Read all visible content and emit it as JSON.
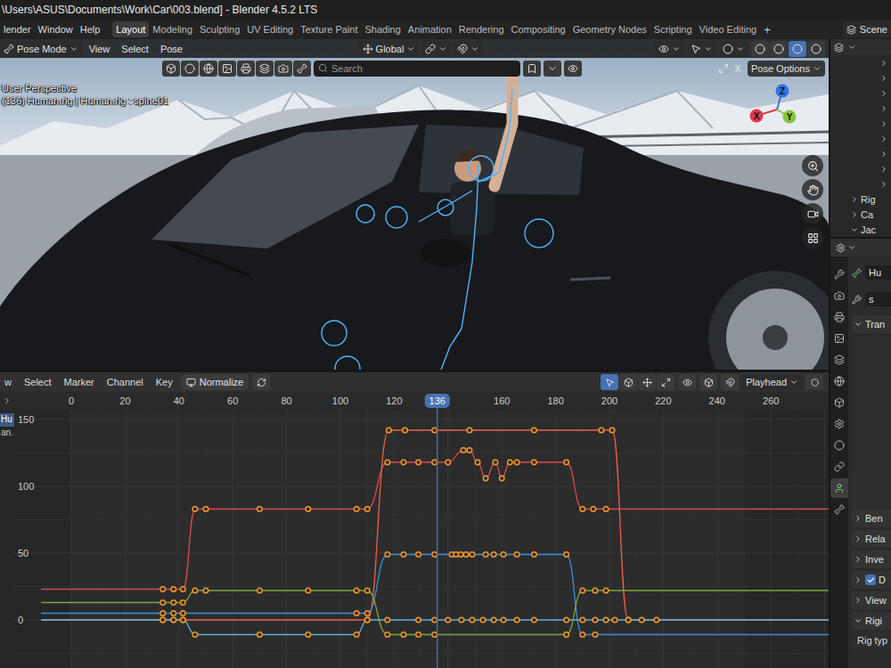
{
  "window": {
    "title": "\\Users\\ASUS\\Documents\\Work\\Car\\003.blend] - Blender 4.5.2 LTS"
  },
  "menus": [
    "lender",
    "Window",
    "Help"
  ],
  "workspaces": [
    {
      "label": "Layout",
      "selected": true
    },
    {
      "label": "Modeling",
      "selected": false
    },
    {
      "label": "Sculpting",
      "selected": false
    },
    {
      "label": "UV Editing",
      "selected": false
    },
    {
      "label": "Texture Paint",
      "selected": false
    },
    {
      "label": "Shading",
      "selected": false
    },
    {
      "label": "Animation",
      "selected": false
    },
    {
      "label": "Rendering",
      "selected": false
    },
    {
      "label": "Compositing",
      "selected": false
    },
    {
      "label": "Geometry Nodes",
      "selected": false
    },
    {
      "label": "Scripting",
      "selected": false
    },
    {
      "label": "Video Editing",
      "selected": false
    }
  ],
  "add_workspace": "+",
  "scene": "Scene",
  "viewport": {
    "mode": "Pose Mode",
    "menus": [
      "View",
      "Select",
      "Pose"
    ],
    "orientation": "Global",
    "search": {
      "placeholder": "Search"
    },
    "close": "X",
    "pose_options": "Pose Options",
    "info": [
      "User Perspective",
      "(136) Human.rig | Human.rig : spine01"
    ],
    "gizmo": [
      {
        "label": "Z",
        "color": "#2f74e6"
      },
      {
        "label": "X",
        "color": "#e0384c"
      },
      {
        "label": "Y",
        "color": "#86c43a"
      }
    ],
    "shading_modes": [
      {
        "selected": false
      },
      {
        "selected": false
      },
      {
        "selected": true
      },
      {
        "selected": false
      }
    ]
  },
  "graph_editor": {
    "menus": [
      "w",
      "Select",
      "Marker",
      "Channel",
      "Key"
    ],
    "normalize": {
      "label": "Normalize",
      "on": false
    },
    "tools": [
      {
        "selected": true
      },
      {
        "selected": false
      },
      {
        "selected": false
      },
      {
        "selected": false
      }
    ],
    "pivot": "Playhead",
    "channels": [
      {
        "label": "Hu",
        "selected": true
      },
      {
        "label": "an.",
        "selected": false
      }
    ],
    "playhead": "136",
    "x_ticks": [
      "0",
      "20",
      "40",
      "60",
      "80",
      "100",
      "120",
      "160",
      "180",
      "200",
      "220",
      "240",
      "260"
    ],
    "y_ticks": [
      "150",
      "100",
      "50",
      "0"
    ],
    "series": [
      {
        "color": "#d94a4a",
        "frames": [
          34,
          38,
          41.5,
          46,
          50,
          70,
          88,
          106,
          110,
          117.5,
          123.5,
          129,
          135,
          140,
          145.7,
          148,
          151,
          154,
          157.6,
          160,
          163,
          165.6,
          172,
          184,
          190,
          194,
          198.7
        ],
        "values": [
          23,
          23,
          23,
          83,
          83,
          83,
          83,
          83,
          83,
          118,
          118,
          118,
          118,
          118,
          127,
          127,
          118,
          106,
          118,
          106,
          118,
          118,
          118,
          118,
          83,
          83,
          83
        ]
      },
      {
        "color": "#e8604c",
        "frames": [
          34,
          38,
          41.5,
          110,
          118,
          124,
          135,
          148,
          172,
          197,
          201,
          207,
          212,
          217.5
        ],
        "values": [
          0,
          0,
          0,
          0,
          142,
          142,
          142,
          142,
          142,
          142,
          142,
          0,
          0,
          0
        ]
      },
      {
        "color": "#3b8fd9",
        "frames": [
          34,
          38,
          41.5,
          106,
          110,
          117.5,
          123.5,
          129,
          135,
          141.4,
          143,
          144.7,
          146.7,
          149,
          154,
          157,
          160.6,
          165.6,
          172,
          184,
          190,
          194.7
        ],
        "values": [
          5,
          5,
          5,
          5,
          5,
          49,
          49,
          49,
          49,
          49,
          49,
          49,
          49,
          49,
          49,
          49,
          49,
          49,
          49,
          49,
          -11,
          -11
        ]
      },
      {
        "color": "#78a83a",
        "frames": [
          34,
          38,
          41.5,
          46,
          50,
          70,
          88,
          106,
          110,
          117.5,
          123.5,
          129,
          135,
          184,
          190,
          194.7,
          198.7
        ],
        "values": [
          13,
          13,
          13,
          22,
          22,
          22,
          22,
          22,
          22,
          -11,
          -11,
          -11,
          -11,
          -11,
          22,
          22,
          22
        ]
      },
      {
        "color": "#5ab4de",
        "frames": [
          34,
          38,
          41.5,
          46,
          70,
          88,
          106,
          110,
          117.5,
          129,
          135,
          140,
          145,
          149,
          153,
          157,
          160.6,
          165.6,
          172,
          184,
          190,
          194.7,
          198.7,
          202,
          207
        ],
        "values": [
          0,
          0,
          0,
          -11,
          -11,
          -11,
          -11,
          0,
          0,
          0,
          0,
          0,
          0,
          0,
          0,
          0,
          0,
          0,
          0,
          0,
          0,
          0,
          0,
          0,
          0
        ]
      }
    ]
  },
  "outliner": {
    "rows": [
      {
        "label": "",
        "expanded": false
      },
      {
        "label": "",
        "expanded": false
      },
      {
        "label": "",
        "expanded": false
      },
      {
        "label": "",
        "expanded": false
      },
      {
        "label": "",
        "expanded": false
      },
      {
        "label": "",
        "expanded": false
      },
      {
        "label": "",
        "expanded": false
      },
      {
        "label": "",
        "expanded": false
      },
      {
        "label": "",
        "expanded": false
      },
      {
        "label": "Rig",
        "expanded": false
      },
      {
        "label": "Ca",
        "expanded": false
      },
      {
        "label": "Jac",
        "expanded": true
      }
    ]
  },
  "properties": {
    "tabs": [
      {
        "selected": false
      },
      {
        "selected": false
      },
      {
        "selected": false
      },
      {
        "selected": false
      },
      {
        "selected": false
      },
      {
        "selected": false
      },
      {
        "selected": false
      },
      {
        "selected": false
      },
      {
        "selected": false
      },
      {
        "selected": false
      },
      {
        "selected": true
      },
      {
        "selected": false
      }
    ],
    "object": "Hu",
    "context": "s",
    "panels": [
      {
        "label": "Tran",
        "expanded": true,
        "kind": "panel",
        "fields": []
      },
      {
        "label": "Ben",
        "expanded": false,
        "kind": "panel",
        "fields": []
      },
      {
        "label": "Rela",
        "expanded": false,
        "kind": "panel",
        "fields": []
      },
      {
        "label": "Inve",
        "expanded": false,
        "kind": "panel",
        "fields": []
      },
      {
        "label": "D",
        "expanded": false,
        "kind": "checkbox",
        "checked": true,
        "fields": []
      },
      {
        "label": "View",
        "expanded": false,
        "kind": "panel",
        "fields": []
      },
      {
        "label": "Rigi",
        "expanded": true,
        "kind": "panel",
        "fields": [
          "Rig typ"
        ]
      }
    ]
  }
}
